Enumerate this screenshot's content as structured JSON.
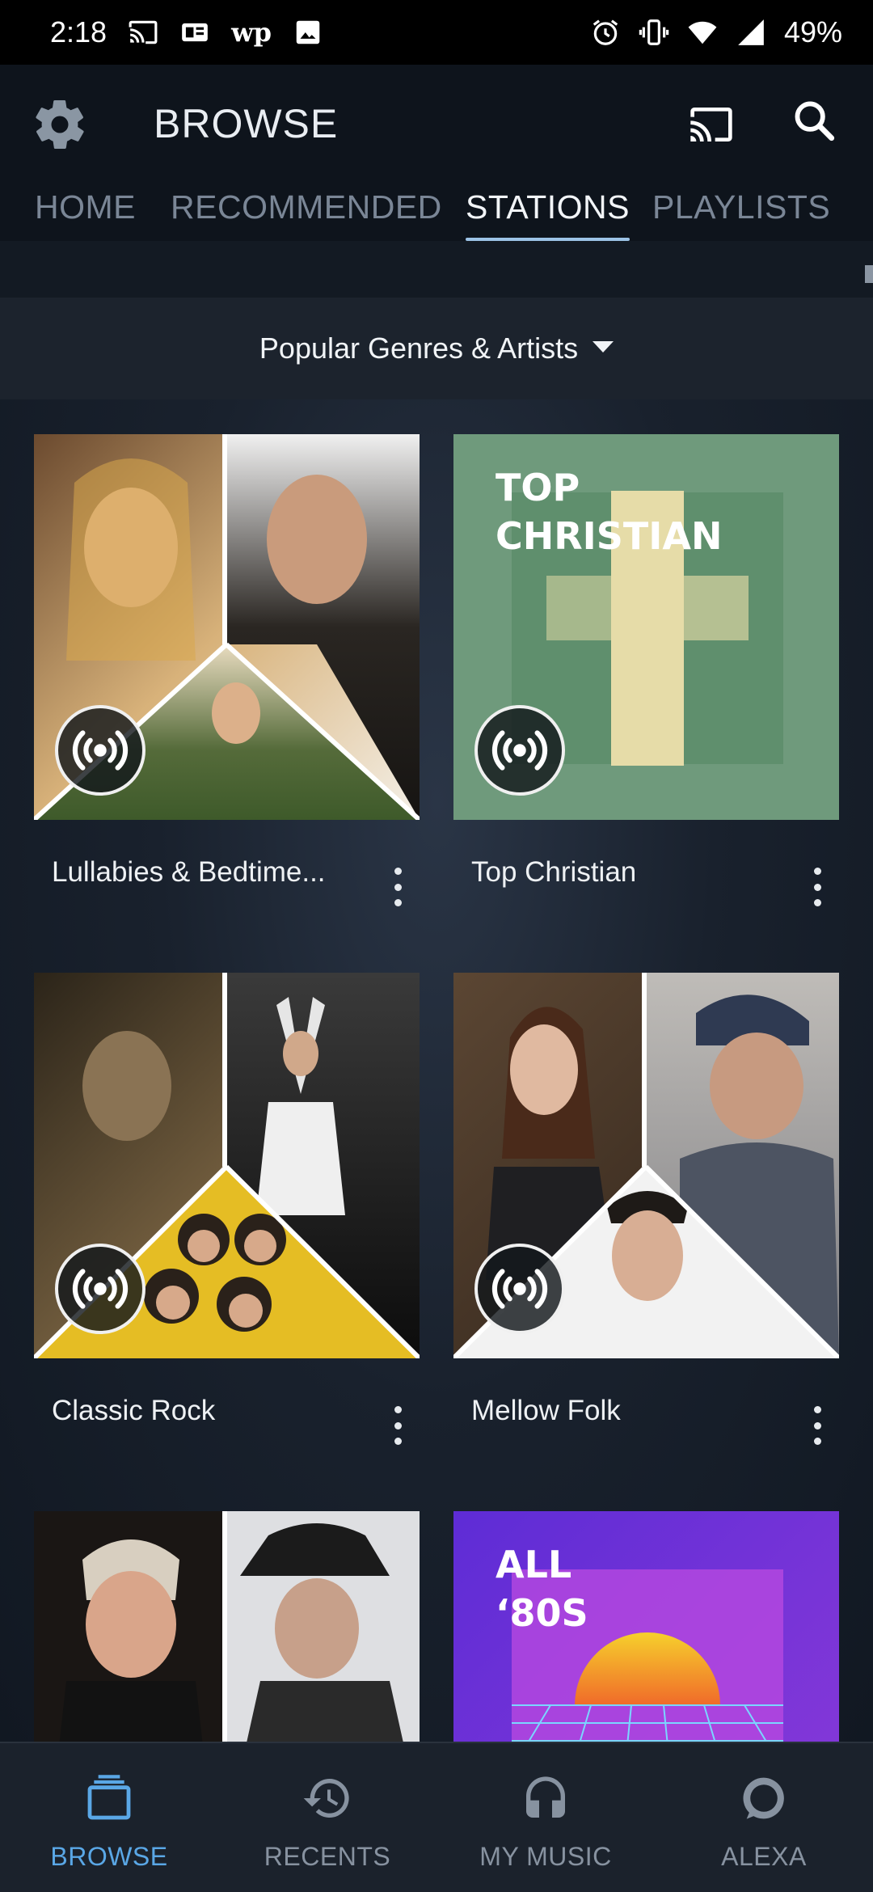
{
  "status_bar": {
    "time": "2:18",
    "battery": "49%",
    "icons": [
      "cast-status-icon",
      "news-icon",
      "wapo-icon",
      "image-icon",
      "alarm-icon",
      "vibrate-icon",
      "wifi-icon",
      "signal-icon",
      "battery-icon"
    ],
    "wapo_text": "wp"
  },
  "app_bar": {
    "title": "BROWSE",
    "tabs": [
      {
        "label": "HOME",
        "active": false
      },
      {
        "label": "RECOMMENDED",
        "active": false
      },
      {
        "label": "STATIONS",
        "active": true
      },
      {
        "label": "PLAYLISTS",
        "active": false
      }
    ]
  },
  "genre_selector": {
    "label": "Popular Genres & Artists"
  },
  "stations": [
    {
      "title": "Lullabies & Bedtime...",
      "art": "collage-warm"
    },
    {
      "title": "Top Christian",
      "art": "top-christian",
      "art_text": [
        "TOP",
        "CHRISTIAN"
      ]
    },
    {
      "title": "Classic Rock",
      "art": "collage-dark"
    },
    {
      "title": "Mellow Folk",
      "art": "collage-folk"
    },
    {
      "title": "",
      "art": "collage-jazz"
    },
    {
      "title": "",
      "art": "all-80s",
      "art_text": [
        "ALL",
        "‘80S"
      ]
    }
  ],
  "bottom_nav": [
    {
      "label": "BROWSE",
      "active": true,
      "icon": "browse-icon"
    },
    {
      "label": "RECENTS",
      "active": false,
      "icon": "history-icon"
    },
    {
      "label": "MY MUSIC",
      "active": false,
      "icon": "headphones-icon"
    },
    {
      "label": "ALEXA",
      "active": false,
      "icon": "alexa-icon"
    }
  ],
  "colors": {
    "accent": "#5aa7e6",
    "tab_underline": "#9cc3e6",
    "background": "#141c27"
  }
}
